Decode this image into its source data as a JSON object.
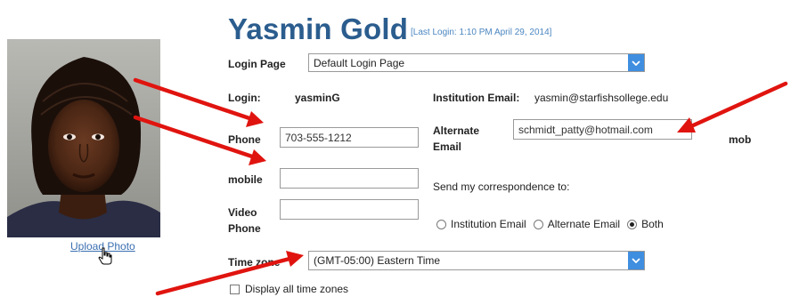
{
  "profile": {
    "name": "Yasmin Gold",
    "last_login": "[Last Login: 1:10 PM April 29, 2014]",
    "upload_photo_label": "Upload Photo"
  },
  "login_page": {
    "label": "Login Page",
    "value": "Default Login Page"
  },
  "login": {
    "label": "Login:",
    "value": "yasminG"
  },
  "institution_email": {
    "label": "Institution Email:",
    "value": "yasmin@starfishsollege.edu"
  },
  "phone": {
    "label": "Phone",
    "value": "703-555-1212"
  },
  "alternate_email": {
    "label_line1": "Alternate",
    "label_line2": "Email",
    "value": "schmidt_patty@hotmail.com"
  },
  "mob_text": "mob",
  "mobile": {
    "label": "mobile",
    "value": ""
  },
  "correspondence": {
    "label": "Send my correspondence to:",
    "options": [
      {
        "label": "Institution Email",
        "checked": false
      },
      {
        "label": "Alternate Email",
        "checked": false
      },
      {
        "label": "Both",
        "checked": true
      }
    ]
  },
  "video_phone": {
    "label_line1": "Video",
    "label_line2": "Phone",
    "value": ""
  },
  "time_zone": {
    "label": "Time zone",
    "value": "(GMT-05:00) Eastern Time"
  },
  "display_all_time_zones": {
    "label": "Display all time zones",
    "checked": false
  },
  "colors": {
    "title": "#2b5d8e",
    "accent": "#3f8ee0",
    "arrow": "#e0140f",
    "link": "#3a6fb0"
  }
}
